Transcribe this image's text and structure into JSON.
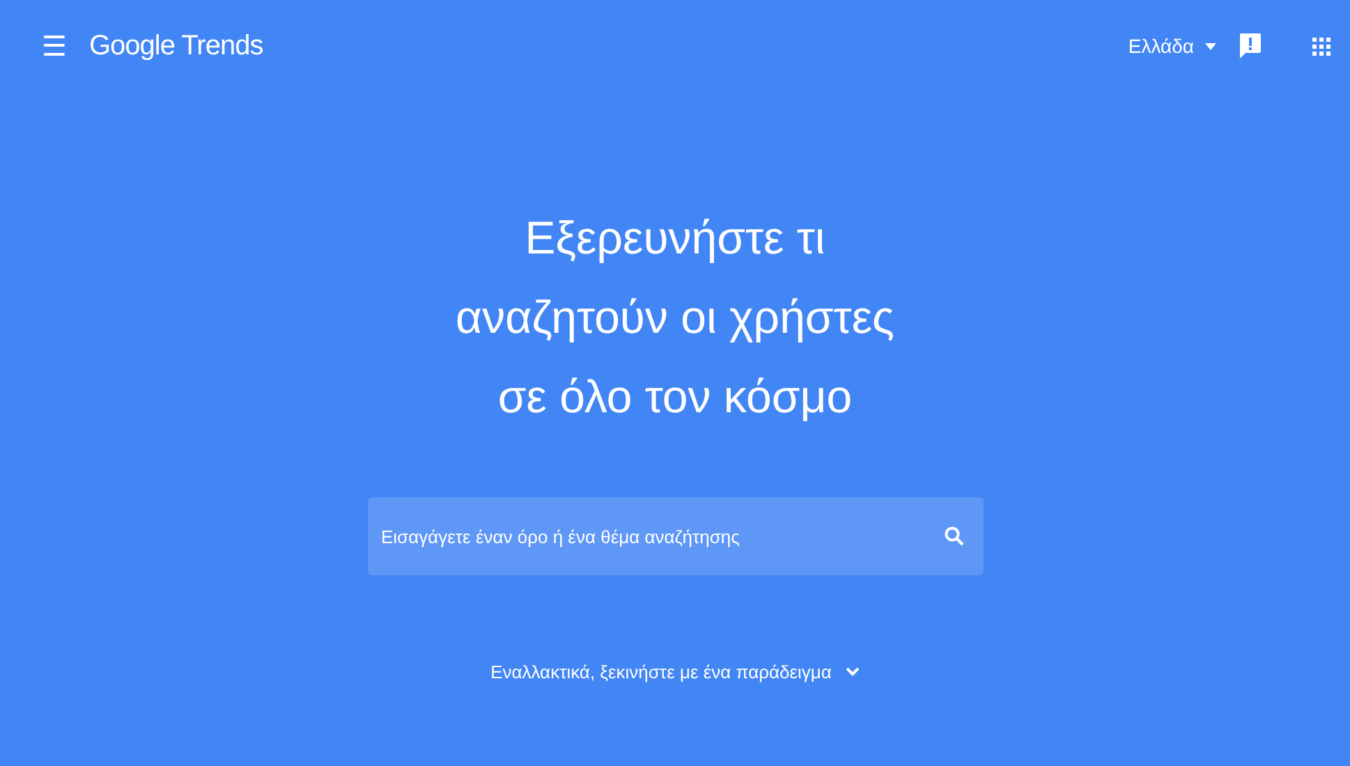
{
  "header": {
    "menu_icon": "☰",
    "logo": "Google Trends",
    "region": "Ελλάδα"
  },
  "hero": {
    "title_lines": [
      "Εξερευνήστε τι",
      "αναζητούν οι χρήστες",
      "σε όλο τον κόσμο"
    ],
    "search": {
      "placeholder": "Εισαγάγετε έναν όρο ή ένα θέμα αναζήτησης"
    },
    "examples_link": "Εναλλακτικά, ξεκινήστε με ένα παράδειγμα"
  }
}
